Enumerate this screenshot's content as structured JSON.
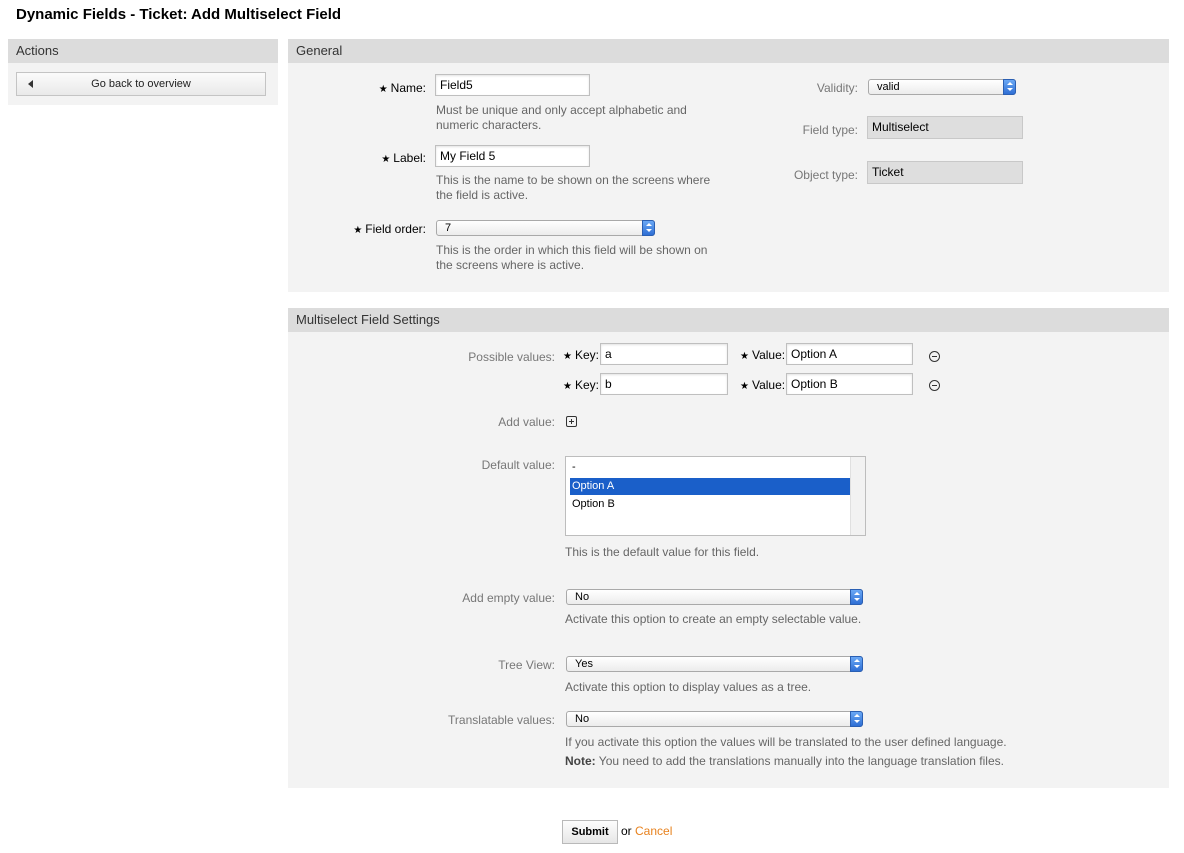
{
  "page_title": "Dynamic Fields - Ticket: Add Multiselect Field",
  "actions": {
    "header": "Actions",
    "back_button": "Go back to overview"
  },
  "general": {
    "header": "General",
    "name": {
      "label": "Name:",
      "value": "Field5",
      "help": [
        "Must be unique and only accept alphabetic and",
        "numeric characters."
      ]
    },
    "label": {
      "label": "Label:",
      "value": "My Field 5",
      "help": [
        "This is the name to be shown on the screens where",
        "the field is active."
      ]
    },
    "field_order": {
      "label": "Field order:",
      "value": "7",
      "help": [
        "This is the order in which this field will be shown on",
        "the screens where is active."
      ]
    },
    "validity": {
      "label": "Validity:",
      "value": "valid"
    },
    "field_type": {
      "label": "Field type:",
      "value": "Multiselect"
    },
    "object_type": {
      "label": "Object type:",
      "value": "Ticket"
    }
  },
  "settings": {
    "header": "Multiselect Field Settings",
    "possible_values_label": "Possible values:",
    "key_label": "Key:",
    "value_label": "Value:",
    "rows": [
      {
        "key": "a",
        "value": "Option A"
      },
      {
        "key": "b",
        "value": "Option B"
      }
    ],
    "add_value_label": "Add value:",
    "default_value": {
      "label": "Default value:",
      "options": [
        "-",
        "Option A",
        "Option B"
      ],
      "selected": "Option A",
      "help": "This is the default value for this field."
    },
    "add_empty_value": {
      "label": "Add empty value:",
      "value": "No",
      "help": "Activate this option to create an empty selectable value."
    },
    "tree_view": {
      "label": "Tree View:",
      "value": "Yes",
      "help": "Activate this option to display values as a tree."
    },
    "translatable_values": {
      "label": "Translatable values:",
      "value": "No",
      "help": "If you activate this option the values will be translated to the user defined language.",
      "note_label": "Note:",
      "note_text": " You need to add the translations manually into the language translation files."
    }
  },
  "footer": {
    "submit": "Submit",
    "or": "or",
    "cancel": "Cancel"
  }
}
